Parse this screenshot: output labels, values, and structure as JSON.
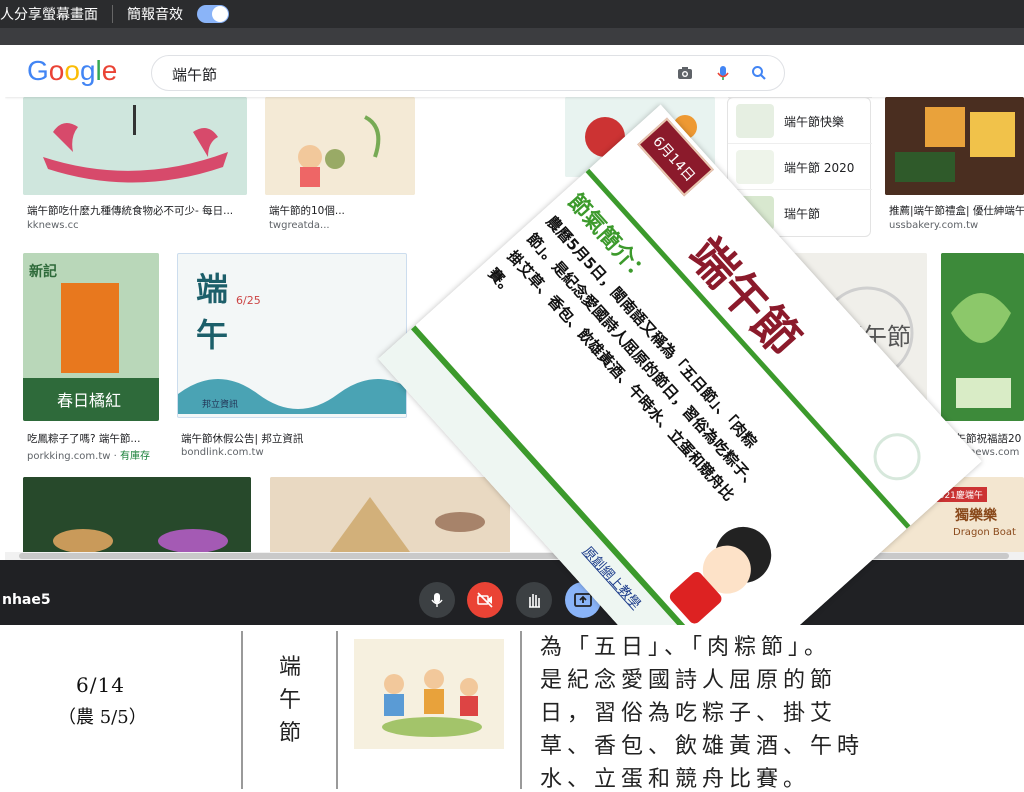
{
  "meet_top": {
    "share_label": "人分享螢幕畫面",
    "sound_label": "簡報音效"
  },
  "google": {
    "logo": [
      "G",
      "o",
      "o",
      "g",
      "l",
      "e"
    ],
    "query": "端午節",
    "results": [
      {
        "caption": "端午節吃什麼九種傳統食物必不可少- 每日...",
        "source": "kknews.cc"
      },
      {
        "caption": "端午節的10個...",
        "source": "twgreatda..."
      },
      {
        "caption": "推薦|端午節禮盒| 優仕紳端午",
        "source": "ussbakery.com.tw"
      },
      {
        "caption": "吃鳳粽子了嗎? 端午節...",
        "source": "porkking.com.tw",
        "stock": "有庫存"
      },
      {
        "caption": "端午節休假公告| 邦立資訊",
        "source": "bondlink.com.tw"
      },
      {
        "caption": "端午節祝福語20",
        "source": "honsnews.com"
      }
    ],
    "related": [
      "端午節快樂",
      "端午節 2020",
      "瑞午節"
    ],
    "tile_texts": {
      "spring_orange": "春日橘紅",
      "duanwu_big": "端午",
      "date_625": "6/25",
      "bondlink": "邦立資訊",
      "newji": "新記",
      "dragon_boat": "Dragon Boat",
      "dulele": "獨樂樂",
      "year_2021": "2021慶端午",
      "kanji": "端午節"
    }
  },
  "meet_bottom": {
    "user": "nhae5"
  },
  "slide": {
    "date_tag": "6月14日",
    "title": "端午節",
    "heading": "節氣簡介：",
    "body": [
      "農曆5月5日，閩南語又稱為「五日節」、「肉粽",
      "節」。是紀念愛國詩人屈原的節日，習俗為吃粽子、",
      "掛艾草、香包、飲雄黃酒、午時水、立蛋和競舟比",
      "賽。"
    ],
    "footer_link": "原創網上教學"
  },
  "doc": {
    "date": "6/14",
    "lunar": "（農 5/5）",
    "title_vertical": "端午節",
    "lines": [
      "為「五日」、「肉粽節」。",
      "是紀念愛國詩人屈原的節",
      "日，習俗為吃粽子、掛艾",
      "草、香包、飲雄黃酒、午時",
      "水、立蛋和競舟比賽。"
    ]
  },
  "colors": {
    "slide_red": "#8b1a2b",
    "slide_green": "#3c9a2c",
    "google_blue": "#4285f4",
    "meet_red": "#ea4335",
    "meet_blue": "#8ab4f8"
  }
}
